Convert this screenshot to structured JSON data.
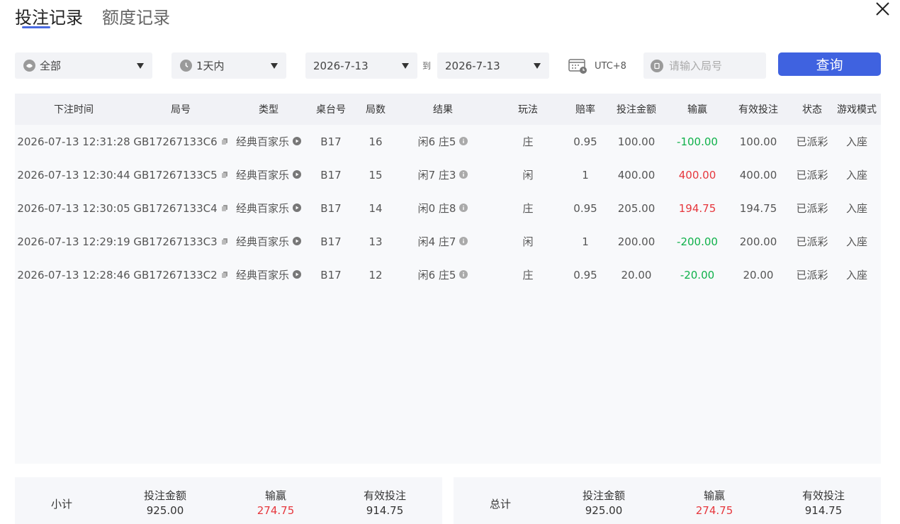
{
  "tabs": [
    {
      "label": "投注记录",
      "active": true
    },
    {
      "label": "额度记录",
      "active": false
    }
  ],
  "filters": {
    "category": "全部",
    "time_range": "1天内",
    "date_from": "2026-7-13",
    "to_label": "到",
    "date_to": "2026-7-13",
    "timezone": "UTC+8",
    "search_placeholder": "请输入局号",
    "query_label": "查询"
  },
  "table": {
    "headers": [
      "下注时间",
      "局号",
      "类型",
      "桌台号",
      "局数",
      "结果",
      "玩法",
      "赔率",
      "投注金额",
      "输赢",
      "有效投注",
      "状态",
      "游戏模式"
    ],
    "rows": [
      {
        "time": "2026-07-13 12:31:28",
        "id": "GB17267133C6",
        "type": "经典百家乐",
        "table": "B17",
        "round": "16",
        "result": "闲6 庄5",
        "play": "庄",
        "odds": "0.95",
        "bet": "100.00",
        "win": "-100.00",
        "win_sign": "neg",
        "valid": "100.00",
        "status": "已派彩",
        "mode": "入座"
      },
      {
        "time": "2026-07-13 12:30:44",
        "id": "GB17267133C5",
        "type": "经典百家乐",
        "table": "B17",
        "round": "15",
        "result": "闲7 庄3",
        "play": "闲",
        "odds": "1",
        "bet": "400.00",
        "win": "400.00",
        "win_sign": "pos",
        "valid": "400.00",
        "status": "已派彩",
        "mode": "入座"
      },
      {
        "time": "2026-07-13 12:30:05",
        "id": "GB17267133C4",
        "type": "经典百家乐",
        "table": "B17",
        "round": "14",
        "result": "闲0 庄8",
        "play": "庄",
        "odds": "0.95",
        "bet": "205.00",
        "win": "194.75",
        "win_sign": "pos",
        "valid": "194.75",
        "status": "已派彩",
        "mode": "入座"
      },
      {
        "time": "2026-07-13 12:29:19",
        "id": "GB17267133C3",
        "type": "经典百家乐",
        "table": "B17",
        "round": "13",
        "result": "闲4 庄7",
        "play": "闲",
        "odds": "1",
        "bet": "200.00",
        "win": "-200.00",
        "win_sign": "neg",
        "valid": "200.00",
        "status": "已派彩",
        "mode": "入座"
      },
      {
        "time": "2026-07-13 12:28:46",
        "id": "GB17267133C2",
        "type": "经典百家乐",
        "table": "B17",
        "round": "12",
        "result": "闲6 庄5",
        "play": "庄",
        "odds": "0.95",
        "bet": "20.00",
        "win": "-20.00",
        "win_sign": "neg",
        "valid": "20.00",
        "status": "已派彩",
        "mode": "入座"
      }
    ]
  },
  "summary": {
    "subtotal": {
      "label": "小计",
      "bet_label": "投注金额",
      "bet": "925.00",
      "win_label": "输赢",
      "win": "274.75",
      "valid_label": "有效投注",
      "valid": "914.75"
    },
    "total": {
      "label": "总计",
      "bet_label": "投注金额",
      "bet": "925.00",
      "win_label": "输赢",
      "win": "274.75",
      "valid_label": "有效投注",
      "valid": "914.75"
    }
  },
  "colors": {
    "accent": "#3f62e0",
    "loss": "#0fb14a",
    "gain": "#e6373d"
  }
}
